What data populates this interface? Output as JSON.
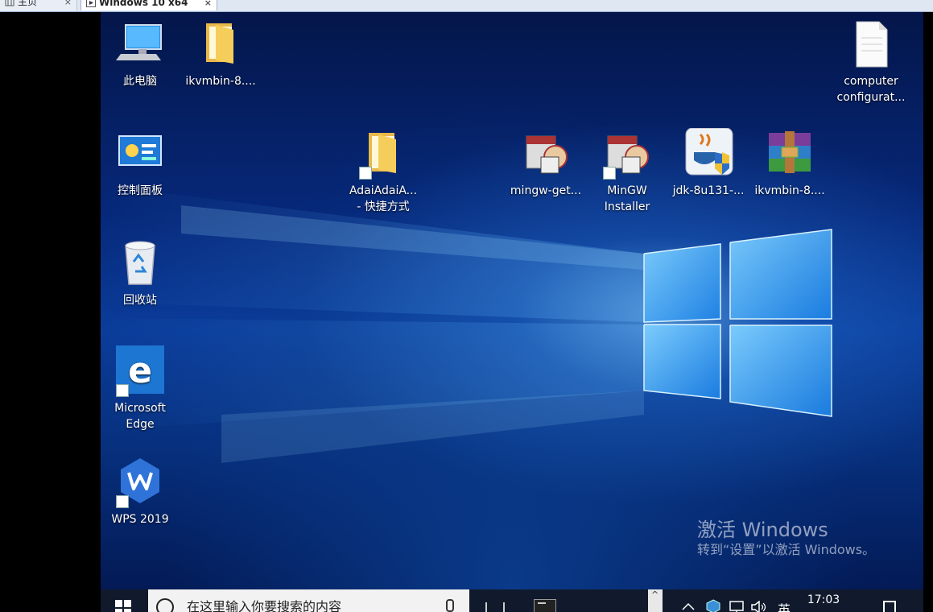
{
  "host": {
    "tabs": [
      {
        "label": "主页",
        "close": "×"
      },
      {
        "label": "Windows 10 x64",
        "close": "×"
      }
    ]
  },
  "desktop": {
    "icons": [
      {
        "label": "此电脑",
        "icon": "computer-icon"
      },
      {
        "label": "ikvmbin-8....",
        "icon": "folder-icon"
      },
      {
        "label": "computer\nconfigurat...",
        "icon": "text-file-icon"
      },
      {
        "label": "控制面板",
        "icon": "control-panel-icon"
      },
      {
        "label": "AdaiAdaiA...\n- 快捷方式",
        "icon": "folder-shortcut-icon"
      },
      {
        "label": "mingw-get...",
        "icon": "installer-icon"
      },
      {
        "label": "MinGW\nInstaller",
        "icon": "installer-shortcut-icon"
      },
      {
        "label": "jdk-8u131-...",
        "icon": "java-installer-icon"
      },
      {
        "label": "ikvmbin-8....",
        "icon": "winrar-archive-icon"
      },
      {
        "label": "回收站",
        "icon": "recycle-bin-icon"
      },
      {
        "label": "Microsoft\nEdge",
        "icon": "edge-icon"
      },
      {
        "label": "WPS 2019",
        "icon": "wps-icon"
      }
    ],
    "activation": {
      "title": "激活 Windows",
      "subtitle": "转到“设置”以激活 Windows。"
    }
  },
  "taskbar": {
    "search_placeholder": "在这里输入你要搜索的内容",
    "ime": "英",
    "time": "17:03"
  },
  "colors": {
    "desktop_bg": "#0a3c9a",
    "taskbar_bg": "#101a2c",
    "search_bg": "#f2f2f2"
  }
}
